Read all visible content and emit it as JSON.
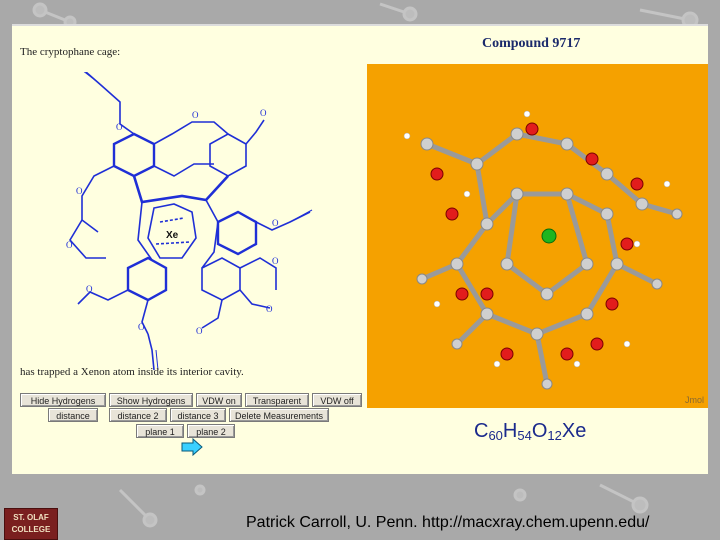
{
  "slide": {
    "left_title": "The cryptophane cage:",
    "left_caption": "has trapped a Xenon atom inside its interior cavity.",
    "center_atom_label": "Xe",
    "compound_title": "Compound 9717",
    "jmol_label": "Jmol",
    "formula": {
      "c": "C",
      "c_n": "60",
      "h": "H",
      "h_n": "54",
      "o": "O",
      "o_n": "12",
      "xe": "Xe"
    },
    "buttons": [
      {
        "label": "Hide Hydrogens"
      },
      {
        "label": "Show Hydrogens"
      },
      {
        "label": "VDW on"
      },
      {
        "label": "Transparent"
      },
      {
        "label": "VDW off"
      },
      {
        "label": "distance"
      },
      {
        "label": "distance 2"
      },
      {
        "label": "distance 3"
      },
      {
        "label": "Delete Measurements"
      },
      {
        "label": "plane 1"
      },
      {
        "label": "plane 2"
      }
    ]
  },
  "footer": {
    "logo_line1": "ST. OLAF",
    "logo_line2": "COLLEGE",
    "credit": "Patrick Carroll, U. Penn. http://macxray.chem.upenn.edu/"
  },
  "colors": {
    "slide_bg": "#ffffe0",
    "jmol_bg": "#f5a100",
    "structure_blue": "#1f2fd6",
    "title_navy": "#1b2a6b"
  }
}
